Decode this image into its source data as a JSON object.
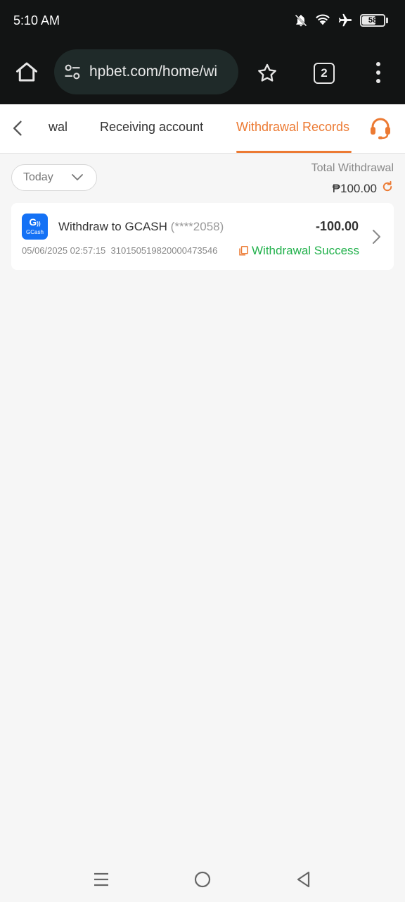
{
  "status_bar": {
    "time": "5:10 AM",
    "battery": "58",
    "battery_level": 0.58,
    "icons": [
      "notifications-off-icon",
      "wifi-icon",
      "airplane-icon",
      "battery-icon"
    ]
  },
  "browser": {
    "url": "hpbet.com/home/wi",
    "tab_count": "2",
    "icons": [
      "home-icon",
      "tune-icon",
      "star-icon",
      "tabs-icon",
      "more-vert-icon"
    ]
  },
  "header": {
    "tabs": [
      {
        "label": "wal",
        "active": false
      },
      {
        "label": "Receiving account",
        "active": false
      },
      {
        "label": "Withdrawal Records",
        "active": true
      }
    ],
    "accent_color": "#ec7a33",
    "icons": [
      "back-icon",
      "customer-support-icon"
    ]
  },
  "filter": {
    "date_label": "Today",
    "total_label": "Total Withdrawal",
    "total_amount": "₱100.00"
  },
  "records": [
    {
      "method_logo_label": "GCash",
      "title": "Withdraw to GCASH",
      "account_masked": "(****2058)",
      "amount": "-100.00",
      "datetime": "05/06/2025 02:57:15",
      "order_id": "310150519820000473546",
      "status": "Withdrawal Success",
      "status_color": "#22b14c"
    }
  ],
  "nav_bar": {
    "icons": [
      "recents-icon",
      "home-circle-icon",
      "back-triangle-icon"
    ]
  }
}
